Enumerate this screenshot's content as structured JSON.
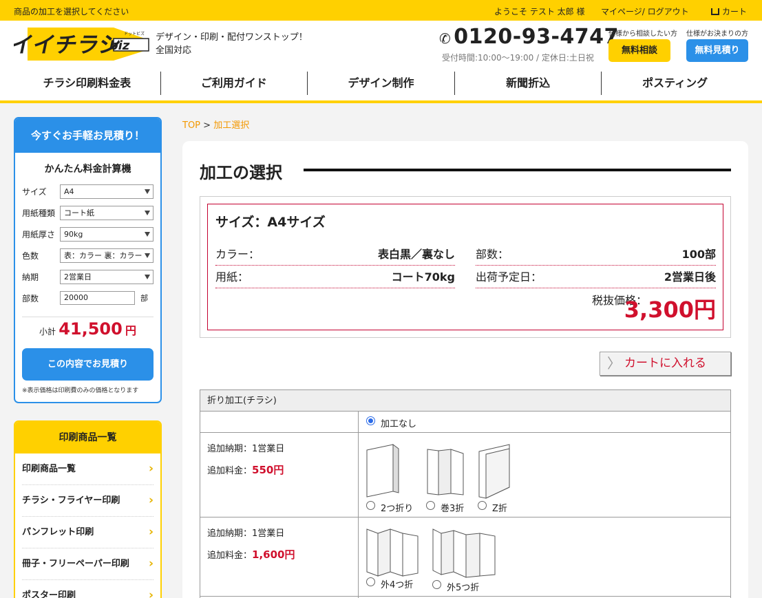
{
  "topbar": {
    "instruction": "商品の加工を選択してください",
    "welcome": "ようこそ テスト 太郎 様",
    "mypage": "マイページ/ ログアウト",
    "cart": "カート"
  },
  "header": {
    "logo_text": "イイチラシ",
    "logo_sub": "biz",
    "logo_ruby": "ドットビズ",
    "tagline_1": "デザイン・印刷・配付ワンストップ！",
    "tagline_2": "全国対応",
    "phone": "0120-93-4747",
    "hours": "受付時間:10:00〜19:00 / 定休日:土日祝",
    "consult_caption": "仕様から相談したい方",
    "consult_button": "無料相談",
    "quote_caption": "仕様がお決まりの方",
    "quote_button": "無料見積り",
    "colors": {
      "accent": "#ffd000",
      "blue": "#2b90e8",
      "price": "#d0102d"
    }
  },
  "nav": [
    "チラシ印刷料金表",
    "ご利用ガイド",
    "デザイン制作",
    "新聞折込",
    "ポスティング"
  ],
  "calculator": {
    "banner": "今すぐお手軽お見積り！",
    "title": "かんたん料金計算機",
    "fields": [
      {
        "label": "サイズ",
        "value": "A4"
      },
      {
        "label": "用紙種類",
        "value": "コート紙"
      },
      {
        "label": "用紙厚さ",
        "value": "90kg"
      },
      {
        "label": "色数",
        "value": "表：カラー 裏：カラー"
      },
      {
        "label": "納期",
        "value": "2営業日"
      }
    ],
    "quantity_label": "部数",
    "quantity_value": "20000",
    "quantity_unit": "部",
    "subtotal_label": "小計",
    "subtotal_value": "41,500",
    "subtotal_unit": "円",
    "button": "この内容でお見積り",
    "note": "※表示価格は印刷費のみの価格となります"
  },
  "products": {
    "title": "印刷商品一覧",
    "items": [
      "印刷商品一覧",
      "チラシ・フライヤー印刷",
      "パンフレット印刷",
      "冊子・フリーペーパー印刷",
      "ポスター印刷"
    ]
  },
  "breadcrumb": {
    "top": "TOP",
    "sep": ">",
    "current": "加工選択"
  },
  "page_title": "加工の選択",
  "summary": {
    "size_title": "サイズ：A4サイズ",
    "color_label": "カラー：",
    "color_value": "表白黒／裏なし",
    "copies_label": "部数：",
    "copies_value": "100部",
    "paper_label": "用紙：",
    "paper_value": "コート70kg",
    "ship_label": "出荷予定日：",
    "ship_value": "2営業日後",
    "price_label": "税抜価格：",
    "price_value": "3,300円"
  },
  "cart_button": "カートに入れる",
  "folding": {
    "header": "折り加工(チラシ)",
    "none_label": "加工なし",
    "groups": [
      {
        "delivery": "追加納期：1営業日",
        "fee_label": "追加料金：",
        "fee": "550円",
        "options": [
          {
            "icon": "half-fold-icon",
            "label": "2つ折り"
          },
          {
            "icon": "roll-fold-icon",
            "label": "巻3折"
          },
          {
            "icon": "z-fold-icon",
            "label": "Z折"
          }
        ]
      },
      {
        "delivery": "追加納期：1営業日",
        "fee_label": "追加料金：",
        "fee": "1,600円",
        "options": [
          {
            "icon": "outer-4-fold-icon",
            "label": "外4つ折"
          },
          {
            "icon": "outer-5-fold-icon",
            "label": "外5つ折"
          }
        ]
      }
    ]
  }
}
